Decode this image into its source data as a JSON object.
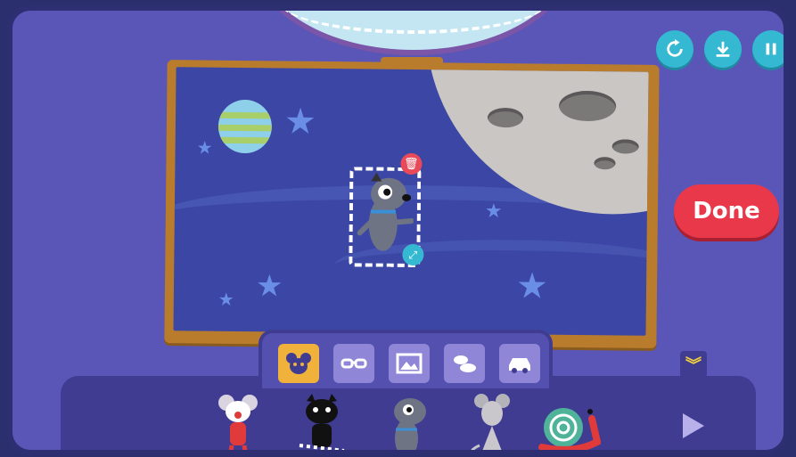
{
  "toolbar": {
    "buttons": [
      {
        "name": "restart",
        "icon": "restart-icon"
      },
      {
        "name": "save",
        "icon": "download-icon"
      },
      {
        "name": "pause",
        "icon": "pause-icon"
      }
    ]
  },
  "done_button": {
    "label": "Done"
  },
  "categories": [
    {
      "name": "characters",
      "icon": "mouse-face-icon",
      "active": true
    },
    {
      "name": "accessories",
      "icon": "glasses-icon",
      "active": false
    },
    {
      "name": "backgrounds",
      "icon": "picture-icon",
      "active": false
    },
    {
      "name": "weather",
      "icon": "clouds-icon",
      "active": false
    },
    {
      "name": "vehicles",
      "icon": "car-icon",
      "active": false
    }
  ],
  "characters": [
    {
      "name": "white-mouse",
      "icon": "mouse-character-icon"
    },
    {
      "name": "black-cat",
      "icon": "cat-character-icon"
    },
    {
      "name": "grey-dog",
      "icon": "dog-character-icon"
    },
    {
      "name": "grey-rat",
      "icon": "rat-character-icon"
    },
    {
      "name": "snail",
      "icon": "snail-character-icon"
    }
  ],
  "colors": {
    "accent": "#35b9d2",
    "done": "#e8384a",
    "active_tab": "#f0b23a",
    "background": "#5a56b8"
  }
}
